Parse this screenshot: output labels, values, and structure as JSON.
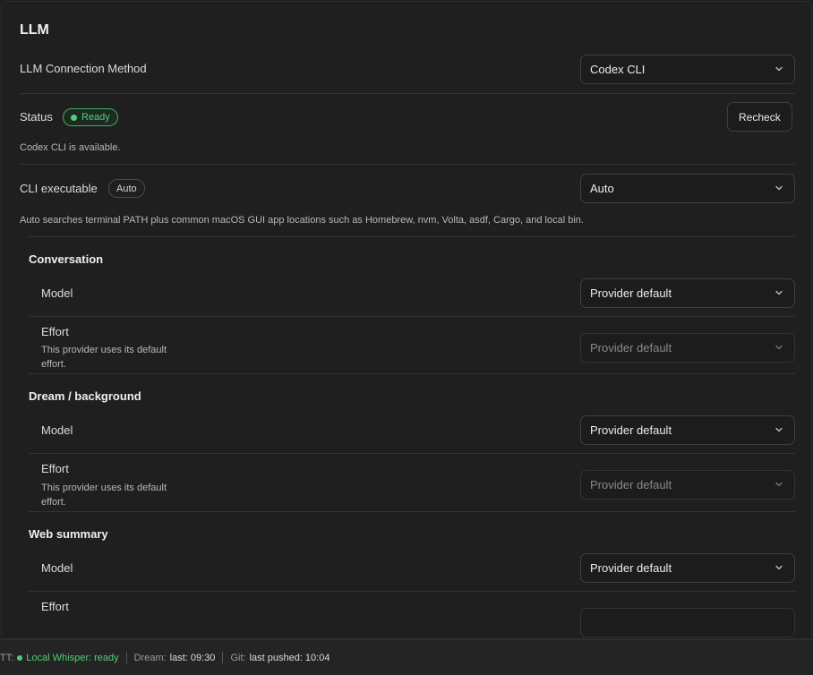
{
  "llm": {
    "title": "LLM",
    "connection": {
      "label": "LLM Connection Method",
      "value": "Codex CLI"
    },
    "status": {
      "label": "Status",
      "badge": "Ready",
      "recheck": "Recheck",
      "message": "Codex CLI is available."
    },
    "cli": {
      "label": "CLI executable",
      "badge": "Auto",
      "value": "Auto",
      "help": "Auto searches terminal PATH plus common macOS GUI app locations such as Homebrew, nvm, Volta, asdf, Cargo, and local bin."
    },
    "groups": [
      {
        "title": "Conversation",
        "model_label": "Model",
        "model_value": "Provider default",
        "effort_label": "Effort",
        "effort_help_1": "This provider uses its default",
        "effort_help_2": "effort.",
        "effort_value": "Provider default"
      },
      {
        "title": "Dream / background",
        "model_label": "Model",
        "model_value": "Provider default",
        "effort_label": "Effort",
        "effort_help_1": "This provider uses its default",
        "effort_help_2": "effort.",
        "effort_value": "Provider default"
      },
      {
        "title": "Web summary",
        "model_label": "Model",
        "model_value": "Provider default",
        "effort_label": "Effort"
      }
    ]
  },
  "statusbar": {
    "stt_prefix": "TT:",
    "stt_value": "Local Whisper: ready",
    "dream_label": "Dream:",
    "dream_value": "last: 09:30",
    "git_label": "Git:",
    "git_value": "last pushed: 10:04"
  },
  "colors": {
    "background": "#1f1f1f",
    "accent_green": "#4fcf76",
    "border": "#3e3e3e"
  }
}
